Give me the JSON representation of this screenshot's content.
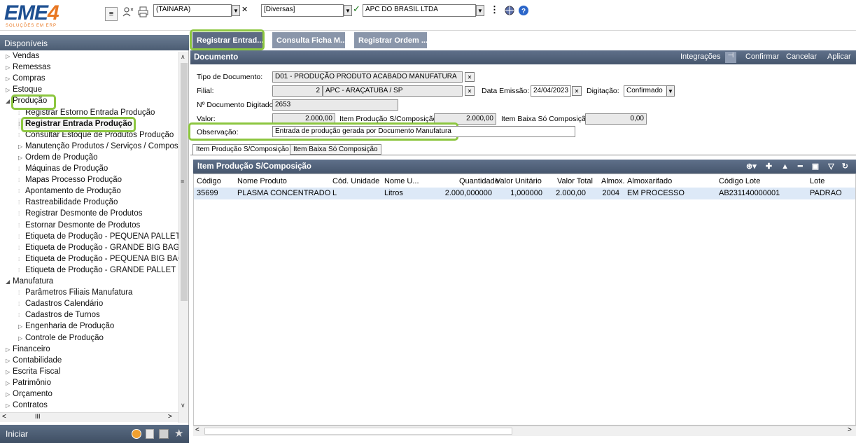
{
  "logo": {
    "main": "EME",
    "num": "4",
    "sub": "SOLUÇÕES EM ERP"
  },
  "topbar": {
    "menu_icon": "≡",
    "user_combo": "(TAINARA)",
    "category_combo": "[Diversas]",
    "company_combo": "APC DO BRASIL LTDA"
  },
  "left": {
    "header": "Disponíveis",
    "items": [
      {
        "label": "Vendas",
        "level": 0,
        "tri": "▷"
      },
      {
        "label": "Remessas",
        "level": 0,
        "tri": "▷"
      },
      {
        "label": "Compras",
        "level": 0,
        "tri": "▷"
      },
      {
        "label": "Estoque",
        "level": 0,
        "tri": "▷"
      },
      {
        "label": "Produção",
        "level": 0,
        "tri": "◢"
      },
      {
        "label": "Registrar Estorno Entrada Produção",
        "level": 1,
        "tri": ""
      },
      {
        "label": "Registrar Entrada Produção",
        "level": 1,
        "tri": ""
      },
      {
        "label": "Consultar Estoque de Produtos Produção",
        "level": 1,
        "tri": ""
      },
      {
        "label": "Manutenção Produtos / Serviços / Composi",
        "level": 1,
        "tri": "▷"
      },
      {
        "label": "Ordem de Produção",
        "level": 1,
        "tri": "▷"
      },
      {
        "label": "Máquinas de Produção",
        "level": 1,
        "tri": ""
      },
      {
        "label": "Mapas Processo Produção",
        "level": 1,
        "tri": ""
      },
      {
        "label": "Apontamento de Produção",
        "level": 1,
        "tri": ""
      },
      {
        "label": "Rastreabilidade Produção",
        "level": 1,
        "tri": ""
      },
      {
        "label": "Registrar Desmonte de Produtos",
        "level": 1,
        "tri": ""
      },
      {
        "label": "Estornar Desmonte de Produtos",
        "level": 1,
        "tri": ""
      },
      {
        "label": "Etiqueta de Produção - PEQUENA PALLET",
        "level": 1,
        "tri": ""
      },
      {
        "label": "Etiqueta de Produção - GRANDE BIG BAG",
        "level": 1,
        "tri": ""
      },
      {
        "label": "Etiqueta de Produção - PEQUENA BIG BAG",
        "level": 1,
        "tri": ""
      },
      {
        "label": "Etiqueta de Produção - GRANDE PALLET",
        "level": 1,
        "tri": ""
      },
      {
        "label": "Manufatura",
        "level": 0,
        "tri": "◢"
      },
      {
        "label": "Parâmetros Filiais Manufatura",
        "level": 1,
        "tri": ""
      },
      {
        "label": "Cadastros Calendário",
        "level": 1,
        "tri": ""
      },
      {
        "label": "Cadastros de Turnos",
        "level": 1,
        "tri": ""
      },
      {
        "label": "Engenharia de Produção",
        "level": 1,
        "tri": "▷"
      },
      {
        "label": "Controle de Produção",
        "level": 1,
        "tri": "▷"
      },
      {
        "label": "Financeiro",
        "level": 0,
        "tri": "▷"
      },
      {
        "label": "Contabilidade",
        "level": 0,
        "tri": "▷"
      },
      {
        "label": "Escrita Fiscal",
        "level": 0,
        "tri": "▷"
      },
      {
        "label": "Patrimônio",
        "level": 0,
        "tri": "▷"
      },
      {
        "label": "Orçamento",
        "level": 0,
        "tri": "▷"
      },
      {
        "label": "Contratos",
        "level": 0,
        "tri": "▷"
      }
    ],
    "start_label": "Iniciar",
    "scroll_mid": "III"
  },
  "tabs": [
    {
      "label": "Registrar Entrad..."
    },
    {
      "label": "Consulta Ficha M..."
    },
    {
      "label": "Registrar Ordem ..."
    }
  ],
  "doc": {
    "title": "Documento",
    "actions": [
      "Integrações",
      "Confirmar",
      "Cancelar",
      "Aplicar"
    ]
  },
  "form": {
    "tipo_label": "Tipo de Documento:",
    "tipo_value": "D01 - PRODUÇÃO PRODUTO ACABADO MANUFATURA",
    "filial_label": "Filial:",
    "filial_num": "2",
    "filial_value": "APC - ARAÇATUBA / SP",
    "data_label": "Data Emissão:",
    "data_value": "24/04/2023",
    "digitacao_label": "Digitação:",
    "digitacao_value": "Confirmado",
    "numdoc_label": "Nº Documento Digitado:",
    "numdoc_value": "2653",
    "valor_label": "Valor:",
    "valor_value": "2.000,00",
    "itemprod_label": "Item Produção S/Composição",
    "itemprod_value": "2.000,00",
    "itembaixa_label": "Item Baixa Só Composição",
    "itembaixa_value": "0,00",
    "obs_label": "Observação:",
    "obs_value": "Entrada de produção gerada por Documento Manufatura"
  },
  "subtabs": [
    "Item Produção S/Composição",
    "Item Baixa Só Composição"
  ],
  "grid": {
    "title": "Item Produção S/Composição",
    "columns": [
      "Código",
      "Nome Produto",
      "Cód. Unidade",
      "Nome U...",
      "Quantidade",
      "Valor Unitário",
      "Valor Total",
      "Almox.",
      "Almoxarifado",
      "Código Lote",
      "Lote"
    ],
    "row": [
      "35699",
      "PLASMA CONCENTRADO",
      "L",
      "Litros",
      "2.000,000000",
      "1,000000",
      "2.000,00",
      "2004",
      "EM PROCESSO",
      "AB231140000001",
      "PADRAO"
    ]
  },
  "colors": {
    "accent_green": "#8cc63f",
    "header_blue": "#4c5d73",
    "brand_blue": "#1d4f91",
    "brand_orange": "#e87722"
  }
}
